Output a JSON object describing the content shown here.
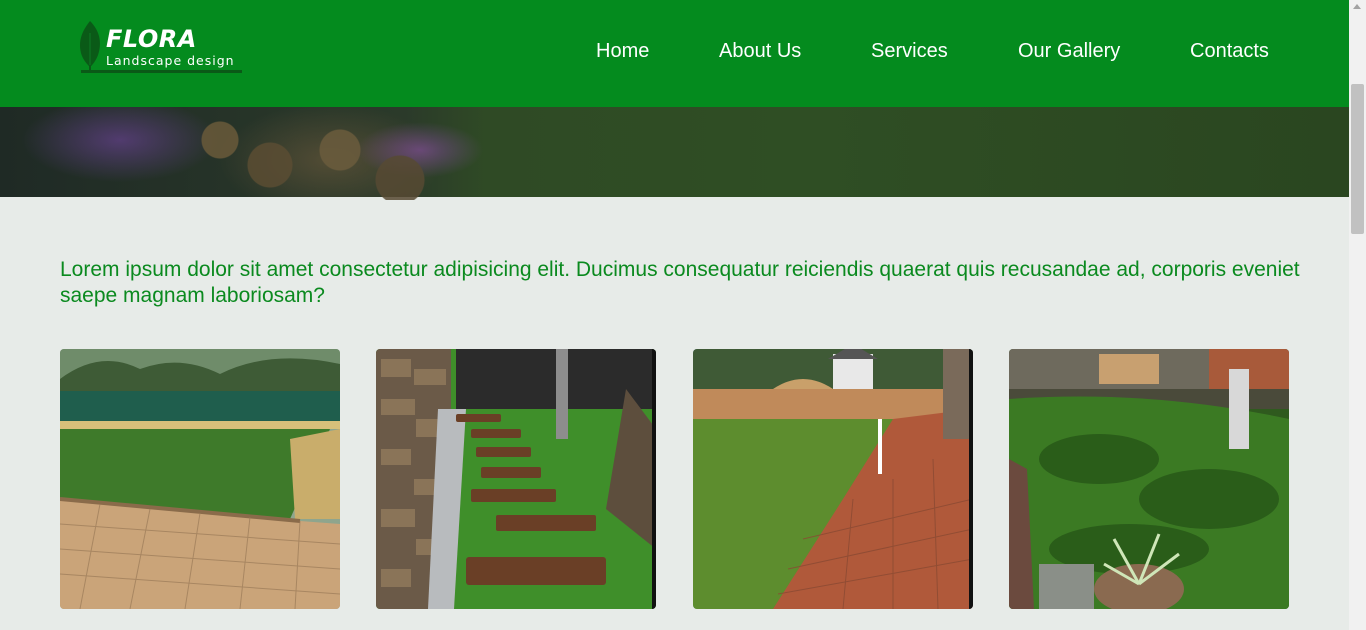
{
  "brand": {
    "name": "FLORA",
    "tagline": "Landscape design"
  },
  "nav": {
    "items": [
      {
        "label": "Home"
      },
      {
        "label": "About Us"
      },
      {
        "label": "Services"
      },
      {
        "label": "Our Gallery"
      },
      {
        "label": "Contacts"
      }
    ]
  },
  "intro": {
    "text": "Lorem ipsum dolor sit amet consectetur adipisicing elit. Ducimus consequatur reiciendis quaerat quis recusandae ad, corporis eveniet saepe magnam laboriosam?"
  },
  "gallery": {
    "images": [
      {
        "subject": "garden-lawn-with-paving-and-retaining-wall"
      },
      {
        "subject": "stepping-stone-path-on-artificial-grass"
      },
      {
        "subject": "lawn-and-brick-paving-with-sprinkler"
      },
      {
        "subject": "shaded-backyard-lawn-with-plants"
      }
    ]
  },
  "colors": {
    "header_bg": "#048b1e",
    "accent_text": "#0b8a1f",
    "page_bg": "#e7ebe8"
  },
  "icons": {
    "logo": "leaf-icon"
  }
}
